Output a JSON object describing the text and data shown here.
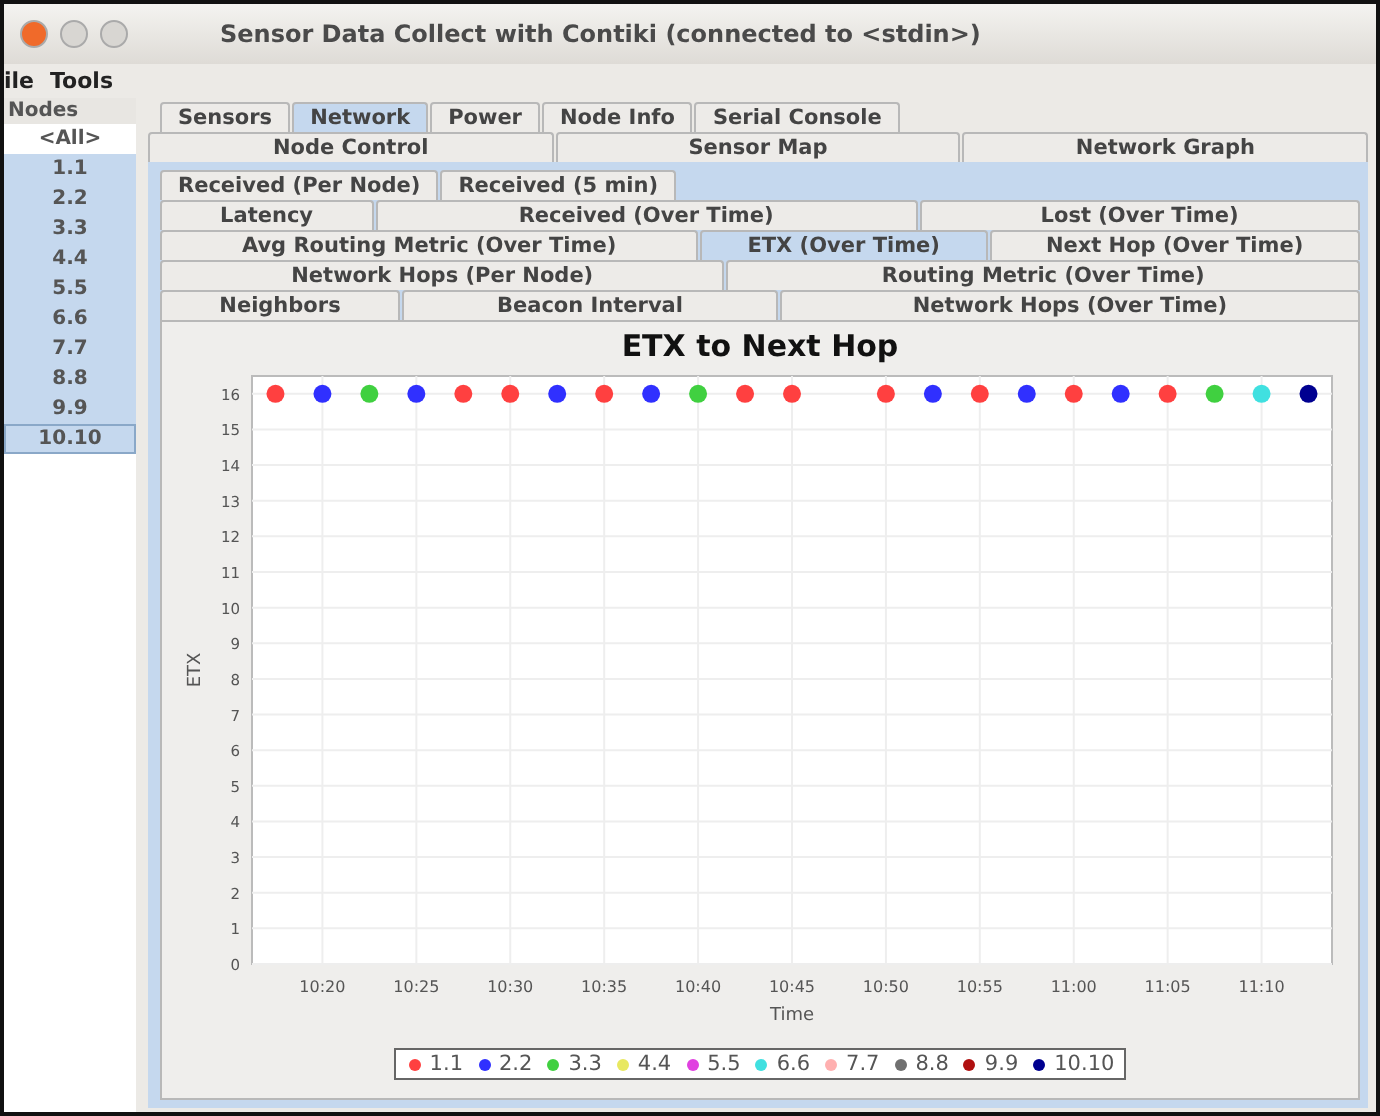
{
  "window": {
    "title": "Sensor Data Collect with Contiki (connected to <stdin>)"
  },
  "menu": [
    "ile",
    "Tools"
  ],
  "nodes": {
    "header": "Nodes",
    "items": [
      {
        "label": "<All>",
        "selected": false,
        "focused": false
      },
      {
        "label": "1.1",
        "selected": true,
        "focused": false
      },
      {
        "label": "2.2",
        "selected": true,
        "focused": false
      },
      {
        "label": "3.3",
        "selected": true,
        "focused": false
      },
      {
        "label": "4.4",
        "selected": true,
        "focused": false
      },
      {
        "label": "5.5",
        "selected": true,
        "focused": false
      },
      {
        "label": "6.6",
        "selected": true,
        "focused": false
      },
      {
        "label": "7.7",
        "selected": true,
        "focused": false
      },
      {
        "label": "8.8",
        "selected": true,
        "focused": false
      },
      {
        "label": "9.9",
        "selected": true,
        "focused": false
      },
      {
        "label": "10.10",
        "selected": true,
        "focused": true
      }
    ]
  },
  "main_tabs": [
    [
      {
        "label": "Sensors",
        "selected": false
      },
      {
        "label": "Network",
        "selected": true
      },
      {
        "label": "Power",
        "selected": false
      },
      {
        "label": "Node Info",
        "selected": false
      },
      {
        "label": "Serial Console",
        "selected": false
      }
    ],
    [
      {
        "label": "Node Control",
        "selected": false
      },
      {
        "label": "Sensor Map",
        "selected": false
      },
      {
        "label": "Network Graph",
        "selected": false
      }
    ]
  ],
  "network_tabs": [
    [
      {
        "label": "Received (Per Node)",
        "selected": false
      },
      {
        "label": "Received (5 min)",
        "selected": false
      }
    ],
    [
      {
        "label": "Latency",
        "selected": false
      },
      {
        "label": "Received (Over Time)",
        "selected": false
      },
      {
        "label": "Lost (Over Time)",
        "selected": false
      }
    ],
    [
      {
        "label": "Avg Routing Metric (Over Time)",
        "selected": false
      },
      {
        "label": "ETX (Over Time)",
        "selected": true
      },
      {
        "label": "Next Hop (Over Time)",
        "selected": false
      }
    ],
    [
      {
        "label": "Network Hops (Per Node)",
        "selected": false
      },
      {
        "label": "Routing Metric (Over Time)",
        "selected": false
      }
    ],
    [
      {
        "label": "Neighbors",
        "selected": false
      },
      {
        "label": "Beacon Interval",
        "selected": false
      },
      {
        "label": "Network Hops (Over Time)",
        "selected": false
      }
    ]
  ],
  "chart": {
    "chart_data": {
      "type": "scatter",
      "title": "ETX to Next Hop",
      "xlabel": "Time",
      "ylabel": "ETX",
      "categories": [
        null,
        "10:20",
        null,
        "10:25",
        null,
        "10:30",
        null,
        "10:35",
        null,
        "10:40",
        null,
        "10:45",
        null,
        "10:50",
        null,
        "10:55",
        null,
        "11:00",
        null,
        "11:05",
        null,
        "11:10",
        null
      ],
      "ylim": [
        0,
        16.5
      ],
      "grid": true,
      "yticks": [
        0,
        1,
        2,
        3,
        4,
        5,
        6,
        7,
        8,
        9,
        10,
        11,
        12,
        13,
        14,
        15,
        16
      ],
      "series": [
        {
          "name": "1.1",
          "color": "#ff4040",
          "values": [
            16,
            null,
            null,
            null,
            16,
            16,
            null,
            16,
            null,
            null,
            16,
            16,
            null,
            16,
            null,
            16,
            null,
            16,
            null,
            16,
            null,
            null,
            null
          ]
        },
        {
          "name": "2.2",
          "color": "#3030ff",
          "values": [
            null,
            16,
            null,
            16,
            null,
            null,
            16,
            null,
            16,
            null,
            null,
            null,
            null,
            null,
            16,
            null,
            16,
            null,
            16,
            null,
            null,
            null,
            null
          ]
        },
        {
          "name": "3.3",
          "color": "#40d040",
          "values": [
            null,
            null,
            16,
            null,
            null,
            null,
            null,
            null,
            null,
            16,
            null,
            null,
            null,
            null,
            null,
            null,
            null,
            null,
            null,
            null,
            16,
            null,
            null
          ]
        },
        {
          "name": "4.4",
          "color": "#e8e860",
          "values": [
            null,
            null,
            null,
            null,
            null,
            null,
            null,
            null,
            null,
            null,
            null,
            null,
            null,
            null,
            null,
            null,
            null,
            null,
            null,
            null,
            null,
            null,
            null
          ]
        },
        {
          "name": "5.5",
          "color": "#e040e0",
          "values": [
            null,
            null,
            null,
            null,
            null,
            null,
            null,
            null,
            null,
            null,
            null,
            null,
            null,
            null,
            null,
            null,
            null,
            null,
            null,
            null,
            null,
            null,
            null
          ]
        },
        {
          "name": "6.6",
          "color": "#40e0e0",
          "values": [
            null,
            null,
            null,
            null,
            null,
            null,
            null,
            null,
            null,
            null,
            null,
            null,
            null,
            null,
            null,
            null,
            null,
            null,
            null,
            null,
            null,
            16,
            null
          ]
        },
        {
          "name": "7.7",
          "color": "#ffb0b0",
          "values": [
            null,
            null,
            null,
            null,
            null,
            null,
            null,
            null,
            null,
            null,
            null,
            null,
            null,
            null,
            null,
            null,
            null,
            null,
            null,
            null,
            null,
            null,
            null
          ]
        },
        {
          "name": "8.8",
          "color": "#707070",
          "values": [
            null,
            null,
            null,
            null,
            null,
            null,
            null,
            null,
            null,
            null,
            null,
            null,
            null,
            null,
            null,
            null,
            null,
            null,
            null,
            null,
            null,
            null,
            null
          ]
        },
        {
          "name": "9.9",
          "color": "#b01010",
          "values": [
            null,
            null,
            null,
            null,
            null,
            null,
            null,
            null,
            null,
            null,
            null,
            null,
            null,
            null,
            null,
            null,
            null,
            null,
            null,
            null,
            null,
            null,
            null
          ]
        },
        {
          "name": "10.10",
          "color": "#000090",
          "values": [
            null,
            null,
            null,
            null,
            null,
            null,
            null,
            null,
            null,
            null,
            null,
            null,
            null,
            null,
            null,
            null,
            null,
            null,
            null,
            null,
            null,
            null,
            16
          ]
        }
      ]
    }
  }
}
